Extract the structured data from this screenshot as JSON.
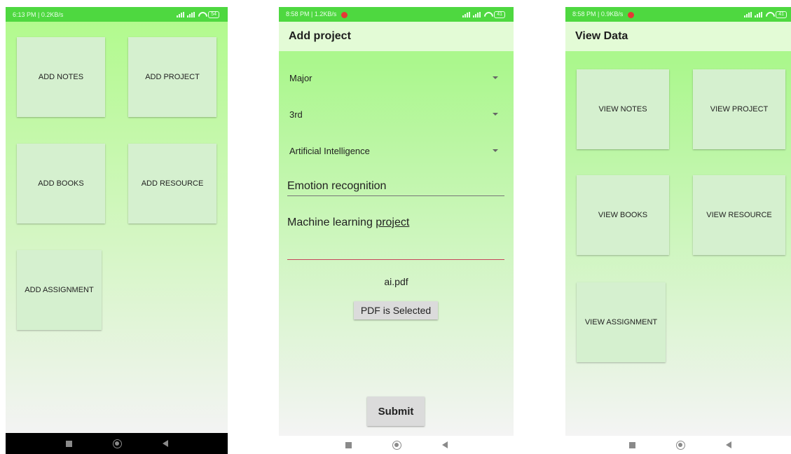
{
  "screen1": {
    "status": {
      "time_info": "6:13 PM | 0.2KB/s",
      "battery": "54"
    },
    "tiles": [
      "ADD NOTES",
      "ADD PROJECT",
      "ADD BOOKS",
      "ADD RESOURCE",
      "ADD ASSIGNMENT"
    ]
  },
  "screen2": {
    "status": {
      "time_info": "8:58 PM | 1.2KB/s",
      "battery": "41"
    },
    "title": "Add project",
    "spinners": [
      "Major",
      "3rd",
      "Artificial Intelligence"
    ],
    "title_field_value": "Emotion recognition",
    "description_prefix": "Machine learning ",
    "description_underlined": "project",
    "file_name": "ai.pdf",
    "pdf_button_label": "PDF is Selected",
    "submit_label": "Submit"
  },
  "screen3": {
    "status": {
      "time_info": "8:58 PM | 0.9KB/s",
      "battery": "41"
    },
    "title": "View Data",
    "tiles": [
      "VIEW NOTES",
      "VIEW PROJECT",
      "VIEW BOOKS",
      "VIEW RESOURCE",
      "VIEW ASSIGNMENT"
    ]
  },
  "icons": {
    "status": [
      "signal-icon",
      "wifi-icon",
      "battery-icon",
      "record-icon"
    ],
    "nav": [
      "nav-recents-icon",
      "nav-home-icon",
      "nav-back-icon"
    ],
    "dropdown": "dropdown-caret-icon"
  },
  "colors": {
    "status_bar": "#4ed840",
    "app_bar": "#e3fbd6",
    "tile": "#d5f0cf",
    "background_top": "#b2fa8e",
    "underline_active": "#c6455a"
  }
}
